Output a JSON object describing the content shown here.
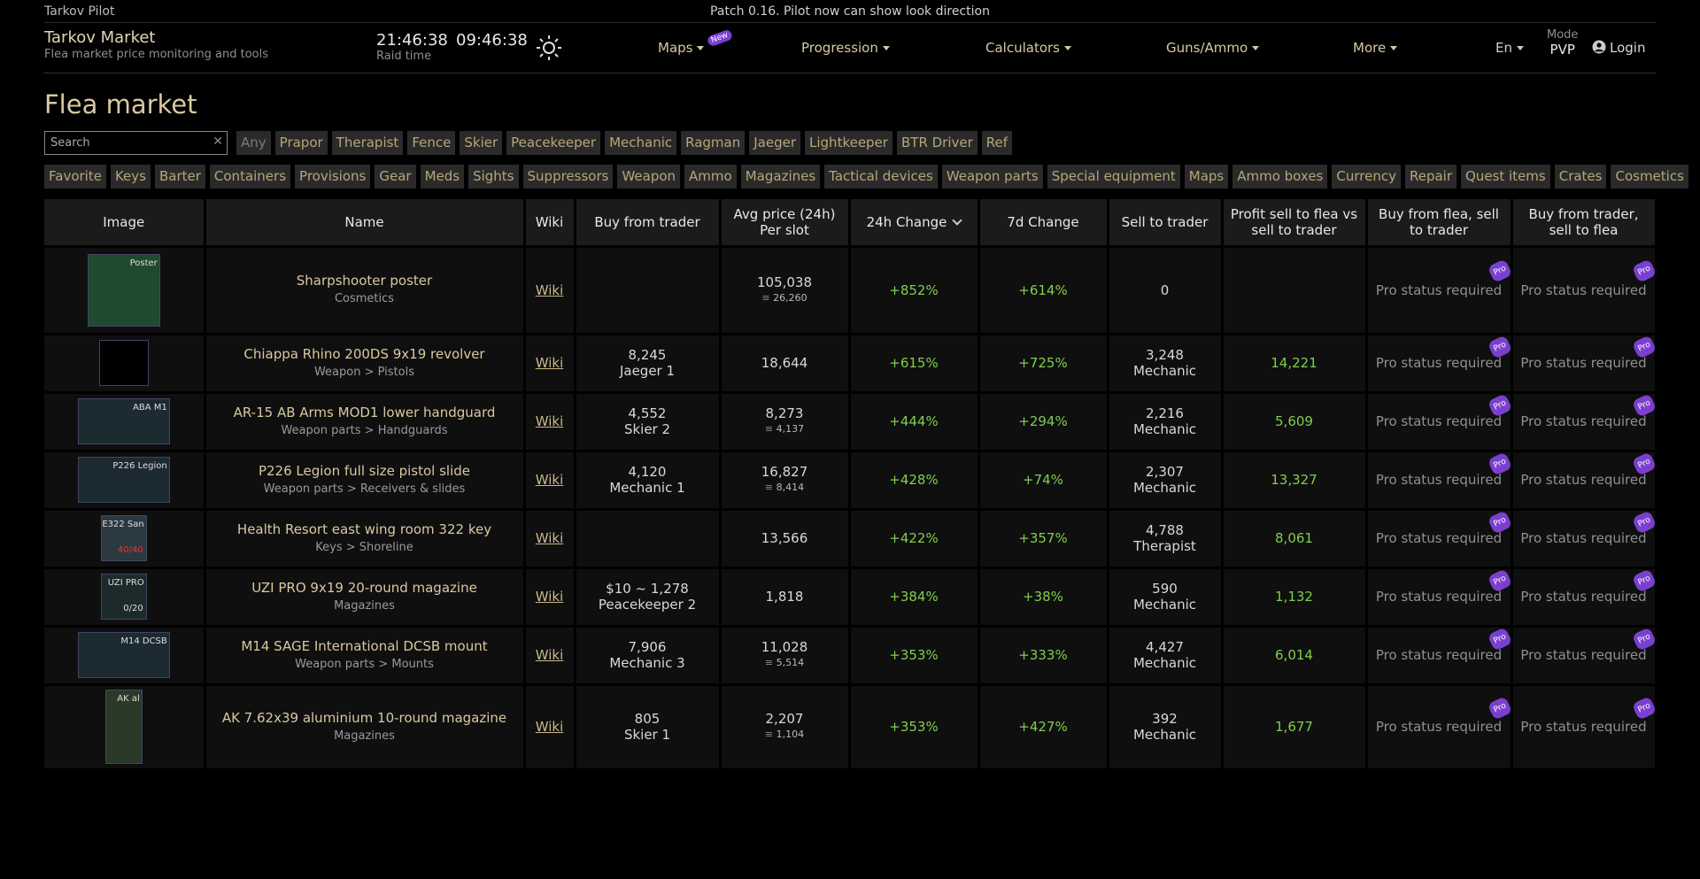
{
  "topbar": {
    "app_name": "Tarkov Pilot",
    "patch_notice": "Patch 0.16. Pilot now can show look direction"
  },
  "header": {
    "title": "Tarkov Market",
    "subtitle": "Flea market price monitoring and tools",
    "clock1": "21:46:38",
    "clock_label": "Raid time",
    "clock2": "09:46:38",
    "nav": [
      {
        "label": "Maps",
        "badge": "New"
      },
      {
        "label": "Progression"
      },
      {
        "label": "Calculators"
      },
      {
        "label": "Guns/Ammo"
      },
      {
        "label": "More"
      }
    ],
    "language": "En",
    "mode_label": "Mode",
    "mode_value": "PVP",
    "login": "Login"
  },
  "page_title": "Flea market",
  "search": {
    "placeholder": "Search",
    "value": ""
  },
  "traders": [
    "Any",
    "Prapor",
    "Therapist",
    "Fence",
    "Skier",
    "Peacekeeper",
    "Mechanic",
    "Ragman",
    "Jaeger",
    "Lightkeeper",
    "BTR Driver",
    "Ref"
  ],
  "categories": [
    "Favorite",
    "Keys",
    "Barter",
    "Containers",
    "Provisions",
    "Gear",
    "Meds",
    "Sights",
    "Suppressors",
    "Weapon",
    "Ammo",
    "Magazines",
    "Tactical devices",
    "Weapon parts",
    "Special equipment",
    "Maps",
    "Ammo boxes",
    "Currency",
    "Repair",
    "Quest items",
    "Crates",
    "Cosmetics"
  ],
  "table": {
    "headers": [
      "Image",
      "Name",
      "Wiki",
      "Buy from trader",
      "Avg price (24h) Per slot",
      "24h Change",
      "7d Change",
      "Sell to trader",
      "Profit sell to flea vs sell to trader",
      "Buy from flea, sell to trader",
      "Buy from trader, sell to flea"
    ],
    "wiki_label": "Wiki",
    "pro_text": "Pro status required",
    "pro_badge": "Pro",
    "rows": [
      {
        "img_tag": "Poster",
        "img_count": "",
        "name": "Sharpshooter poster",
        "category": "Cosmetics",
        "buy_price": "",
        "buy_trader": "",
        "avg": "105,038",
        "per_slot": "26,260",
        "ch24": "+852%",
        "ch7": "+614%",
        "sell_price": "0",
        "sell_trader": "",
        "profit": ""
      },
      {
        "img_tag": "",
        "img_count": "",
        "name": "Chiappa Rhino 200DS 9x19 revolver",
        "category": "Weapon > Pistols",
        "buy_price": "8,245",
        "buy_trader": "Jaeger 1",
        "avg": "18,644",
        "per_slot": "",
        "ch24": "+615%",
        "ch7": "+725%",
        "sell_price": "3,248",
        "sell_trader": "Mechanic",
        "profit": "14,221"
      },
      {
        "img_tag": "ABA M1",
        "img_count": "",
        "name": "AR-15 AB Arms MOD1 lower handguard",
        "category": "Weapon parts > Handguards",
        "buy_price": "4,552",
        "buy_trader": "Skier 2",
        "avg": "8,273",
        "per_slot": "4,137",
        "ch24": "+444%",
        "ch7": "+294%",
        "sell_price": "2,216",
        "sell_trader": "Mechanic",
        "profit": "5,609"
      },
      {
        "img_tag": "P226 Legion",
        "img_count": "",
        "name": "P226 Legion full size pistol slide",
        "category": "Weapon parts > Receivers & slides",
        "buy_price": "4,120",
        "buy_trader": "Mechanic 1",
        "avg": "16,827",
        "per_slot": "8,414",
        "ch24": "+428%",
        "ch7": "+74%",
        "sell_price": "2,307",
        "sell_trader": "Mechanic",
        "profit": "13,327"
      },
      {
        "img_tag": "E322 San",
        "img_count": "40/40",
        "name": "Health Resort east wing room 322 key",
        "category": "Keys > Shoreline",
        "buy_price": "",
        "buy_trader": "",
        "avg": "13,566",
        "per_slot": "",
        "ch24": "+422%",
        "ch7": "+357%",
        "sell_price": "4,788",
        "sell_trader": "Therapist",
        "profit": "8,061"
      },
      {
        "img_tag": "UZI PRO",
        "img_count": "0/20",
        "name": "UZI PRO 9x19 20-round magazine",
        "category": "Magazines",
        "buy_price": "$10 ~ 1,278",
        "buy_trader": "Peacekeeper 2",
        "avg": "1,818",
        "per_slot": "",
        "ch24": "+384%",
        "ch7": "+38%",
        "sell_price": "590",
        "sell_trader": "Mechanic",
        "profit": "1,132"
      },
      {
        "img_tag": "M14 DCSB",
        "img_count": "",
        "name": "M14 SAGE International DCSB mount",
        "category": "Weapon parts > Mounts",
        "buy_price": "7,906",
        "buy_trader": "Mechanic 3",
        "avg": "11,028",
        "per_slot": "5,514",
        "ch24": "+353%",
        "ch7": "+333%",
        "sell_price": "4,427",
        "sell_trader": "Mechanic",
        "profit": "6,014"
      },
      {
        "img_tag": "AK al",
        "img_count": "",
        "name": "AK 7.62x39 aluminium 10-round magazine",
        "category": "Magazines",
        "buy_price": "805",
        "buy_trader": "Skier 1",
        "avg": "2,207",
        "per_slot": "1,104",
        "ch24": "+353%",
        "ch7": "+427%",
        "sell_price": "392",
        "sell_trader": "Mechanic",
        "profit": "1,677"
      }
    ]
  }
}
